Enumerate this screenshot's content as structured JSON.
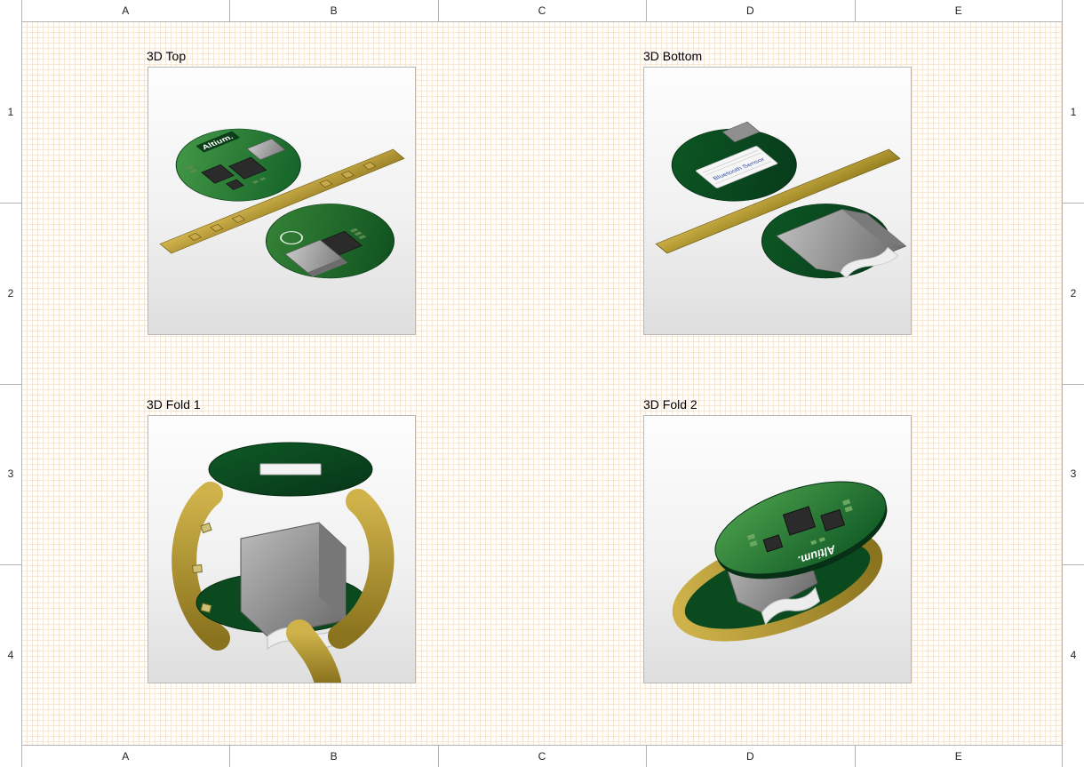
{
  "rulers": {
    "cols": [
      "A",
      "B",
      "C",
      "D",
      "E"
    ],
    "rows": [
      "1",
      "2",
      "3",
      "4"
    ]
  },
  "views": {
    "top": {
      "label": "3D Top"
    },
    "bottom": {
      "label": "3D Bottom"
    },
    "fold1": {
      "label": "3D Fold 1"
    },
    "fold2": {
      "label": "3D Fold 2"
    }
  },
  "pcb": {
    "logo_text": "Altium.",
    "label_text": "Bluetooth Sensor",
    "colors": {
      "pcb_dark": "#0c5a25",
      "pcb_mid": "#2f8a3c",
      "pcb_light": "#5aad56",
      "flex": "#b99a2a",
      "flex_dark": "#8a7520",
      "chip_dark": "#303030",
      "chip_mid": "#4a4a4a",
      "chip_light": "#8a8a8a",
      "module": "#a6a6a6",
      "module_d": "#7a7a7a",
      "white": "#f4f4f4"
    }
  }
}
